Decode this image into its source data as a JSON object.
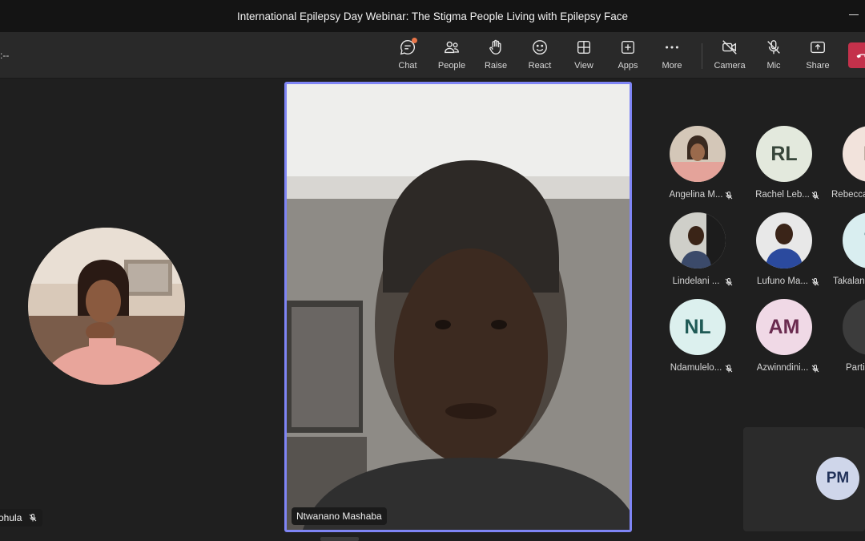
{
  "window": {
    "title": "International Epilepsy Day Webinar: The Stigma People Living with Epilepsy Face"
  },
  "toolbar": {
    "timer": ":--",
    "buttons": [
      {
        "id": "chat",
        "label": "Chat",
        "icon": "chat-icon"
      },
      {
        "id": "people",
        "label": "People",
        "icon": "people-icon"
      },
      {
        "id": "raise",
        "label": "Raise",
        "icon": "hand-icon"
      },
      {
        "id": "react",
        "label": "React",
        "icon": "smile-icon"
      },
      {
        "id": "view",
        "label": "View",
        "icon": "grid-icon"
      },
      {
        "id": "apps",
        "label": "Apps",
        "icon": "plus-square-icon"
      },
      {
        "id": "more",
        "label": "More",
        "icon": "more-icon"
      },
      {
        "id": "camera",
        "label": "Camera",
        "icon": "camera-off-icon"
      },
      {
        "id": "mic",
        "label": "Mic",
        "icon": "mic-off-icon"
      },
      {
        "id": "share",
        "label": "Share",
        "icon": "share-icon"
      }
    ],
    "colors": {
      "leave": "#c4314b",
      "notification": "#e97548"
    }
  },
  "stage": {
    "left_participant": {
      "name": "ohula"
    },
    "main_participant": {
      "name": "Ntwanano Mashaba",
      "highlight_color": "#7f85f5"
    },
    "gallery": [
      {
        "name": "Angelina M...",
        "initials": "",
        "photo": true
      },
      {
        "name": "Rachel Leb...",
        "initials": "RL",
        "bg": "#e3e9dd",
        "fg": "#37463a"
      },
      {
        "name": "Rebecca",
        "initials": "R",
        "bg": "#f2e3dc",
        "fg": "#5a3a2e"
      },
      {
        "name": "Lindelani ...",
        "initials": "",
        "photo": true
      },
      {
        "name": "Lufuno Ma...",
        "initials": "",
        "photo": true
      },
      {
        "name": "Takalan",
        "initials": "T",
        "bg": "#d9eef0",
        "fg": "#235157"
      },
      {
        "name": "Ndamulelo...",
        "initials": "NL",
        "bg": "#dcf0ee",
        "fg": "#1f5a55"
      },
      {
        "name": "Azwinndini...",
        "initials": "AM",
        "bg": "#f0d9e6",
        "fg": "#6a2b4f"
      },
      {
        "name": "Parti",
        "initials": "",
        "bg": "#3c3c3c",
        "fg": "#ffffff"
      }
    ],
    "self_view": {
      "initials": "PM"
    }
  }
}
